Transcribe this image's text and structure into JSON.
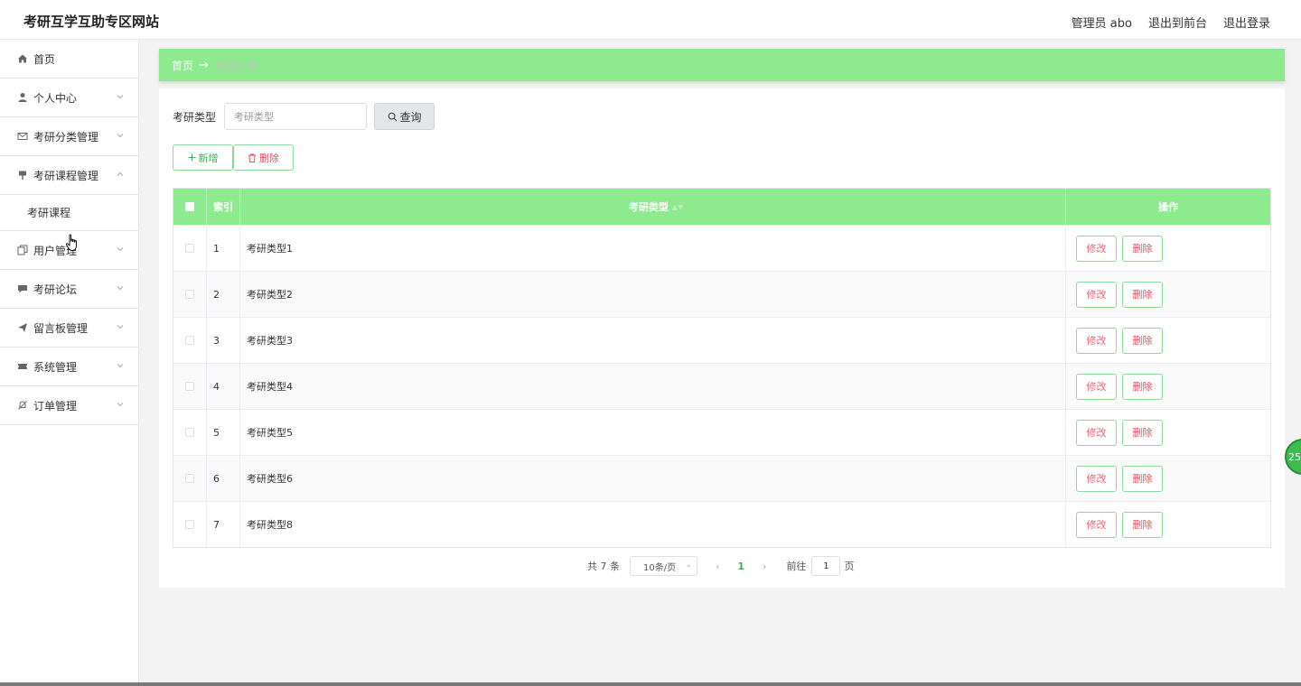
{
  "header": {
    "title": "考研互学互助专区网站",
    "admin": "管理员 abo",
    "to_front": "退出到前台",
    "logout": "退出登录"
  },
  "sidebar": {
    "items": [
      {
        "label": "首页",
        "icon": "home-icon"
      },
      {
        "label": "个人中心",
        "icon": "user-icon"
      },
      {
        "label": "考研分类管理",
        "icon": "mail-icon"
      },
      {
        "label": "考研课程管理",
        "icon": "pin-icon",
        "expanded": true,
        "children": [
          {
            "label": "考研课程"
          }
        ]
      },
      {
        "label": "用户管理",
        "icon": "copy-icon"
      },
      {
        "label": "考研论坛",
        "icon": "chat-icon"
      },
      {
        "label": "留言板管理",
        "icon": "send-icon"
      },
      {
        "label": "系统管理",
        "icon": "ticket-icon"
      },
      {
        "label": "订单管理",
        "icon": "bell-off-icon"
      }
    ]
  },
  "breadcrumb": {
    "home": "首页",
    "arrow": "→",
    "current": "考研分类"
  },
  "search": {
    "label": "考研类型",
    "placeholder": "考研类型",
    "button": "查询"
  },
  "actions": {
    "add": "新增",
    "delete": "删除"
  },
  "table": {
    "columns": [
      "索引",
      "考研类型",
      "操作"
    ],
    "rows": [
      {
        "index": "1",
        "type": "考研类型1"
      },
      {
        "index": "2",
        "type": "考研类型2"
      },
      {
        "index": "3",
        "type": "考研类型3"
      },
      {
        "index": "4",
        "type": "考研类型4"
      },
      {
        "index": "5",
        "type": "考研类型5"
      },
      {
        "index": "6",
        "type": "考研类型6"
      },
      {
        "index": "7",
        "type": "考研类型8"
      }
    ],
    "edit_label": "修改",
    "delete_label": "删除"
  },
  "pager": {
    "total": "共 7 条",
    "page_size": "10条/页",
    "current_page": "1",
    "goto_label": "前往",
    "goto_value": "1",
    "page_unit": "页"
  },
  "float_badge": "25",
  "colors": {
    "accent": "#8eea8f",
    "danger": "#e04f5f",
    "success": "#3fae5a"
  }
}
